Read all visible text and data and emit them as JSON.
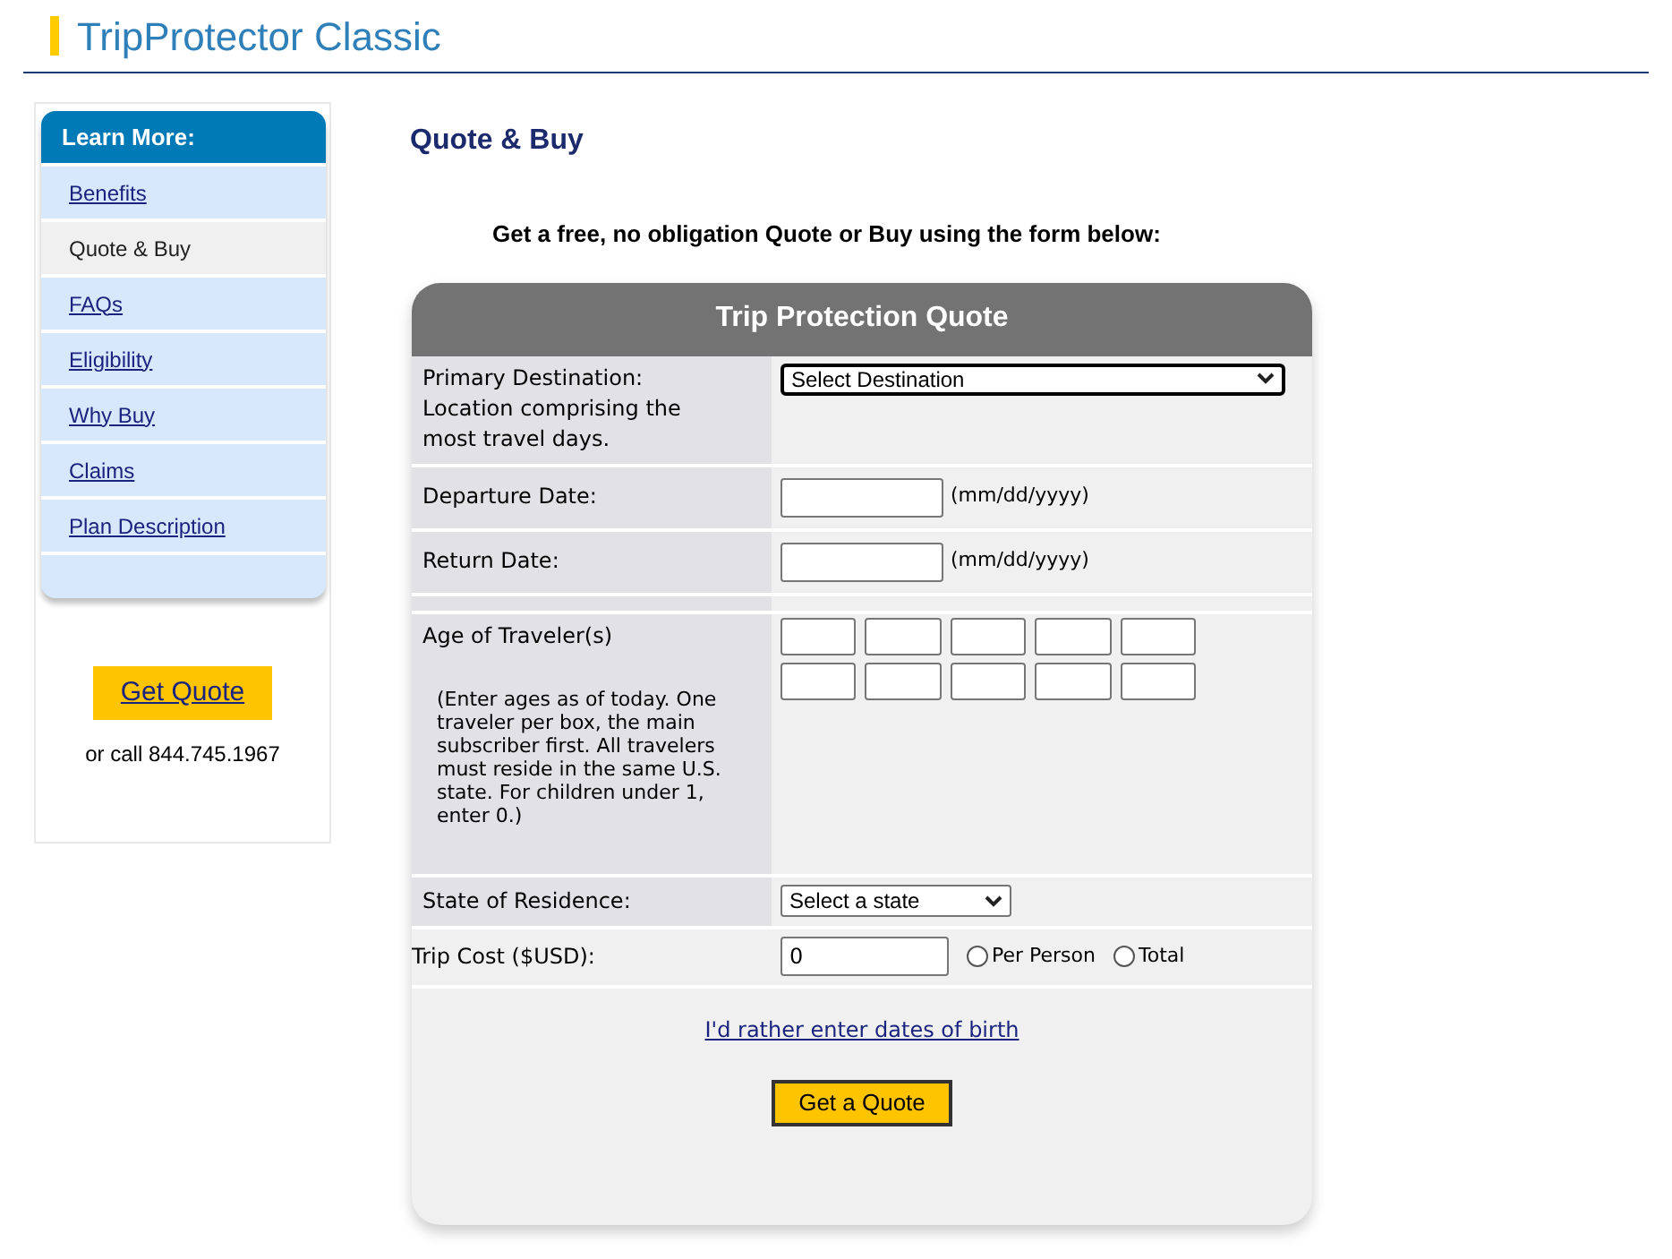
{
  "header": {
    "title": "TripProtector Classic"
  },
  "sidebar": {
    "heading": "Learn More:",
    "items": [
      {
        "label": "Benefits",
        "selected": false
      },
      {
        "label": "Quote & Buy",
        "selected": true
      },
      {
        "label": "FAQs",
        "selected": false
      },
      {
        "label": "Eligibility",
        "selected": false
      },
      {
        "label": "Why Buy",
        "selected": false
      },
      {
        "label": "Claims",
        "selected": false
      },
      {
        "label": "Plan Description",
        "selected": false
      }
    ],
    "cta_button": "Get Quote",
    "phone_text": "or call 844.745.1967"
  },
  "main": {
    "heading": "Quote & Buy",
    "intro": "Get a free, no obligation Quote or Buy using the form below:"
  },
  "form": {
    "title": "Trip Protection Quote",
    "rows": [
      {
        "kind": "wide_select",
        "label": "Primary Destination: Location comprising the most travel days.",
        "value": "Select Destination"
      },
      {
        "kind": "date",
        "label": "Departure Date:",
        "hint": "(mm/dd/yyyy)"
      },
      {
        "kind": "date",
        "label": "Return Date:",
        "hint": "(mm/dd/yyyy)"
      },
      {
        "kind": "ages",
        "label": "Age of Traveler(s)",
        "note": "(Enter ages as of today. One traveler per box, the main subscriber first. All travelers must reside in the same U.S. state. For children under 1, enter 0.)"
      },
      {
        "kind": "select",
        "label": "State of Residence:",
        "value": "Select a state"
      },
      {
        "kind": "cost",
        "label": "Trip Cost ($USD):",
        "value": "0",
        "options": [
          {
            "label": "Per Person",
            "selected": false
          },
          {
            "label": "Total",
            "selected": false
          }
        ]
      }
    ],
    "link": "I'd rather enter dates of birth",
    "submit": "Get a Quote"
  }
}
